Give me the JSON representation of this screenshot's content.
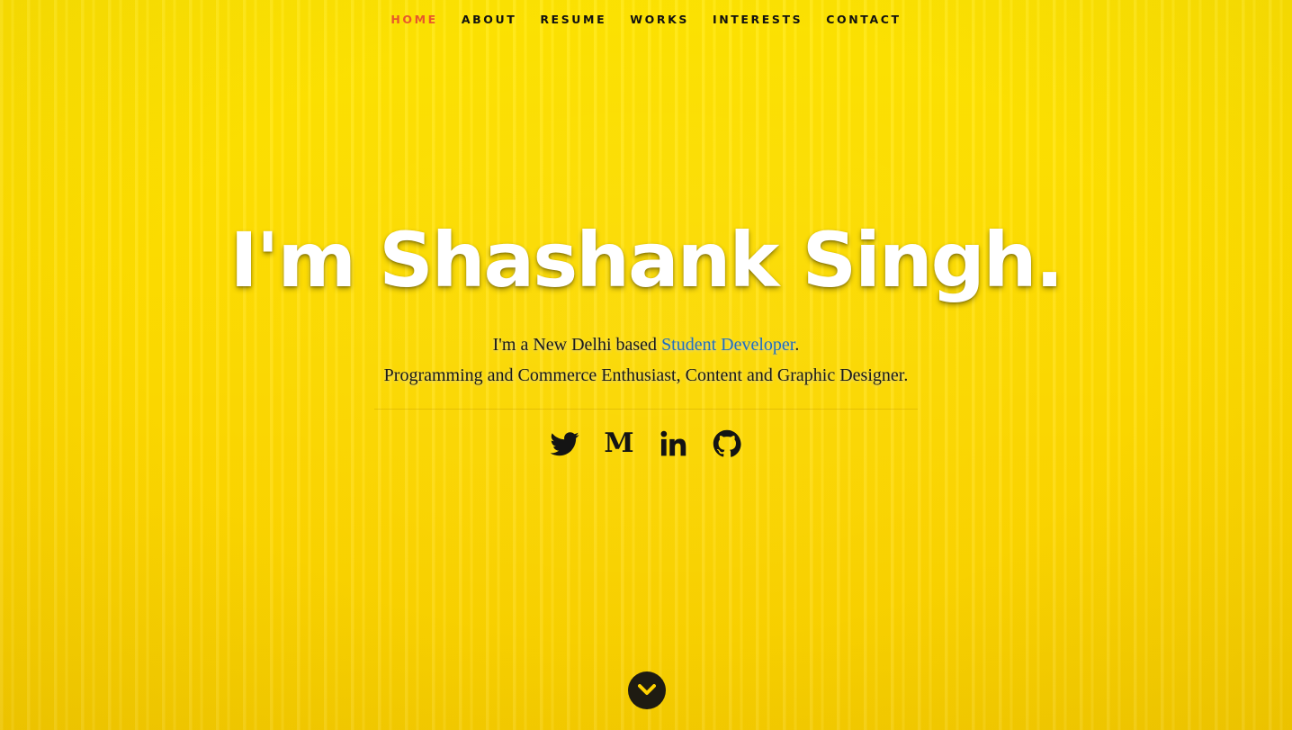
{
  "nav": {
    "items": [
      {
        "label": "HOME",
        "active": true
      },
      {
        "label": "ABOUT",
        "active": false
      },
      {
        "label": "RESUME",
        "active": false
      },
      {
        "label": "WORKS",
        "active": false
      },
      {
        "label": "INTERESTS",
        "active": false
      },
      {
        "label": "CONTACT",
        "active": false
      }
    ]
  },
  "hero": {
    "title": "I'm Shashank Singh.",
    "line1_prefix": "I'm a New Delhi based ",
    "line1_highlight": "Student Developer",
    "line1_suffix": ".",
    "line2": "Programming and Commerce Enthusiast, Content and Graphic Designer."
  },
  "socials": [
    {
      "name": "twitter-icon"
    },
    {
      "name": "medium-icon",
      "glyph": "M"
    },
    {
      "name": "linkedin-icon"
    },
    {
      "name": "github-icon"
    }
  ],
  "scroll": {
    "icon": "chevron-down-icon"
  },
  "colors": {
    "background": "#ffe100",
    "nav_active": "#e8582b",
    "highlight": "#1f6fc0",
    "title": "#ffffff",
    "text": "#1a1a1a"
  }
}
